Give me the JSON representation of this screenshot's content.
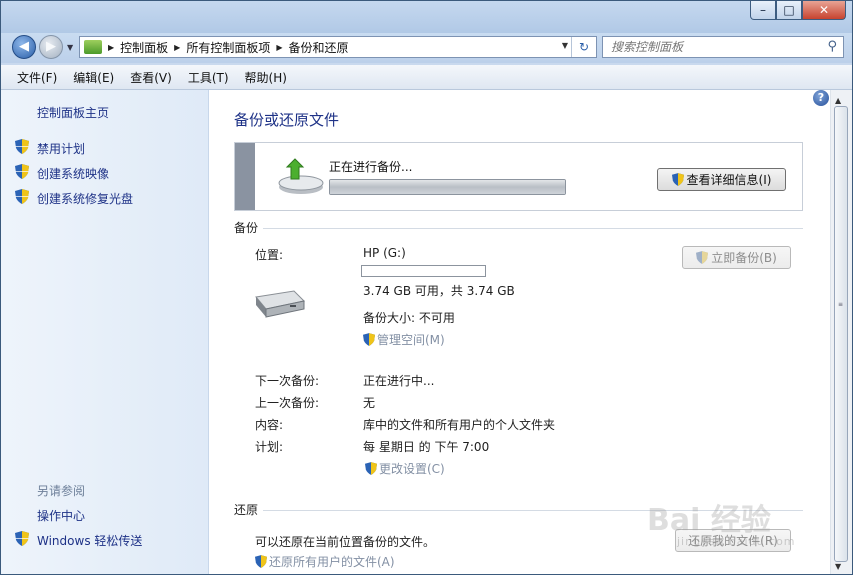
{
  "window": {
    "caption_buttons": {
      "minimize": "–",
      "maximize": "□",
      "close": "✕"
    }
  },
  "nav": {
    "back_icon": "◀",
    "forward_icon": "▶",
    "breadcrumb": [
      "控制面板",
      "所有控制面板项",
      "备份和还原"
    ],
    "search_placeholder": "搜索控制面板"
  },
  "menu": [
    "文件(F)",
    "编辑(E)",
    "查看(V)",
    "工具(T)",
    "帮助(H)"
  ],
  "sidebar": {
    "home": "控制面板主页",
    "tasks": [
      "禁用计划",
      "创建系统映像",
      "创建系统修复光盘"
    ],
    "see_also_label": "另请参阅",
    "see_also": [
      "操作中心",
      "Windows 轻松传送"
    ]
  },
  "main": {
    "title": "备份或还原文件",
    "progress": {
      "status": "正在进行备份...",
      "fraction": 0.0,
      "details_button": "查看详细信息(I)"
    },
    "backup": {
      "heading": "备份",
      "location_label": "位置:",
      "location_value": "HP (G:)",
      "drive_used_fraction": 0.0,
      "free_space": "3.74 GB 可用，共 3.74 GB",
      "backup_size": "备份大小: 不可用",
      "manage_space": "管理空间(M)",
      "backup_now_button": "立即备份(B)",
      "next_label": "下一次备份:",
      "next_value": "正在进行中...",
      "last_label": "上一次备份:",
      "last_value": "无",
      "contents_label": "内容:",
      "contents_value": "库中的文件和所有用户的个人文件夹",
      "schedule_label": "计划:",
      "schedule_value": "每 星期日 的 下午 7:00",
      "change_settings": "更改设置(C)"
    },
    "restore": {
      "heading": "还原",
      "description": "可以还原在当前位置备份的文件。",
      "restore_all": "还原所有用户的文件(A)",
      "restore_my_button": "还原我的文件(R)"
    }
  },
  "help_icon": "?",
  "watermark": {
    "text": "Bai 经验",
    "sub": "jingyan.baidu.com"
  },
  "colors": {
    "link": "#1e3287",
    "disabled": "#8d8d8d",
    "accent": "#3a7fd0"
  }
}
